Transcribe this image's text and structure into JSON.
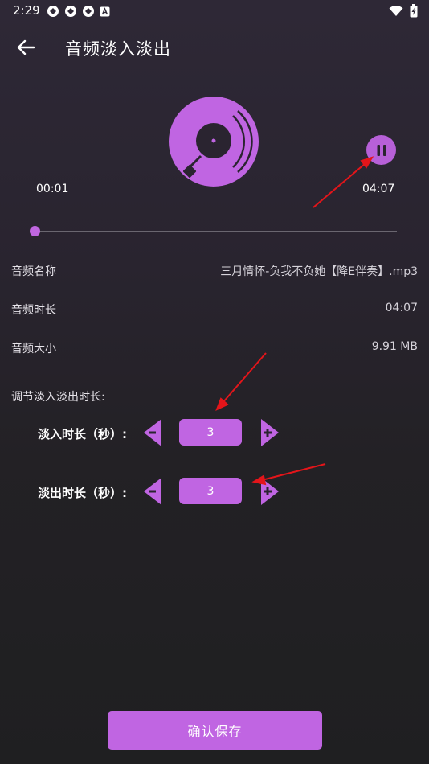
{
  "status_bar": {
    "time": "2:29"
  },
  "header": {
    "title": "音频淡入淡出"
  },
  "player": {
    "current_time": "00:01",
    "total_time": "04:07",
    "progress": 0.004
  },
  "info": {
    "name_label": "音频名称",
    "name_value": "三月情怀-负我不负她【降E伴奏】.mp3",
    "duration_label": "音频时长",
    "duration_value": "04:07",
    "size_label": "音频大小",
    "size_value": "9.91 MB"
  },
  "adjust": {
    "section_label": "调节淡入淡出时长:",
    "fade_in_label": "淡入时长（秒）:",
    "fade_in_value": "3",
    "fade_out_label": "淡出时长（秒）:",
    "fade_out_value": "3"
  },
  "footer": {
    "save_label": "确认保存"
  },
  "colors": {
    "accent": "#c065e2",
    "background": "#29242f"
  }
}
